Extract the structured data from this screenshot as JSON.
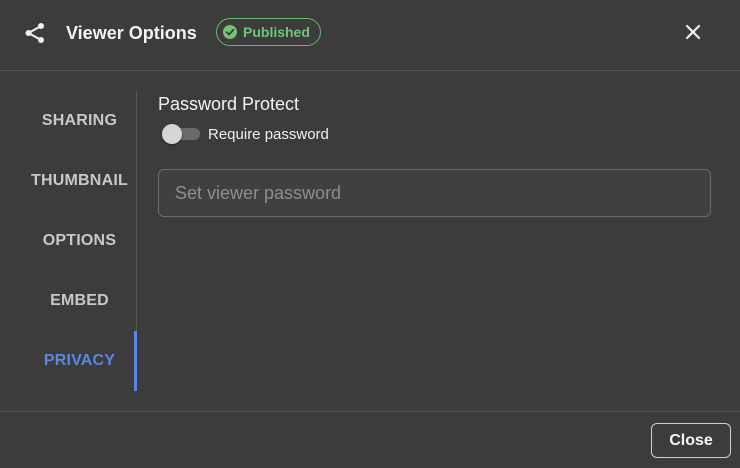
{
  "header": {
    "share_icon": "share-icon",
    "title": "Viewer Options",
    "badge": {
      "label": "Published",
      "icon": "check-circle-icon",
      "color": "#72c477"
    },
    "close_icon": "close-icon"
  },
  "sidebar": {
    "tabs": [
      {
        "label": "SHARING",
        "active": false
      },
      {
        "label": "THUMBNAIL",
        "active": false
      },
      {
        "label": "OPTIONS",
        "active": false
      },
      {
        "label": "EMBED",
        "active": false
      },
      {
        "label": "PRIVACY",
        "active": true
      }
    ],
    "active_color": "#5b86e5"
  },
  "privacy": {
    "section_title": "Password Protect",
    "toggle": {
      "label": "Require password",
      "checked": false
    },
    "password_field": {
      "value": "",
      "placeholder": "Set viewer password"
    }
  },
  "footer": {
    "close_label": "Close"
  }
}
